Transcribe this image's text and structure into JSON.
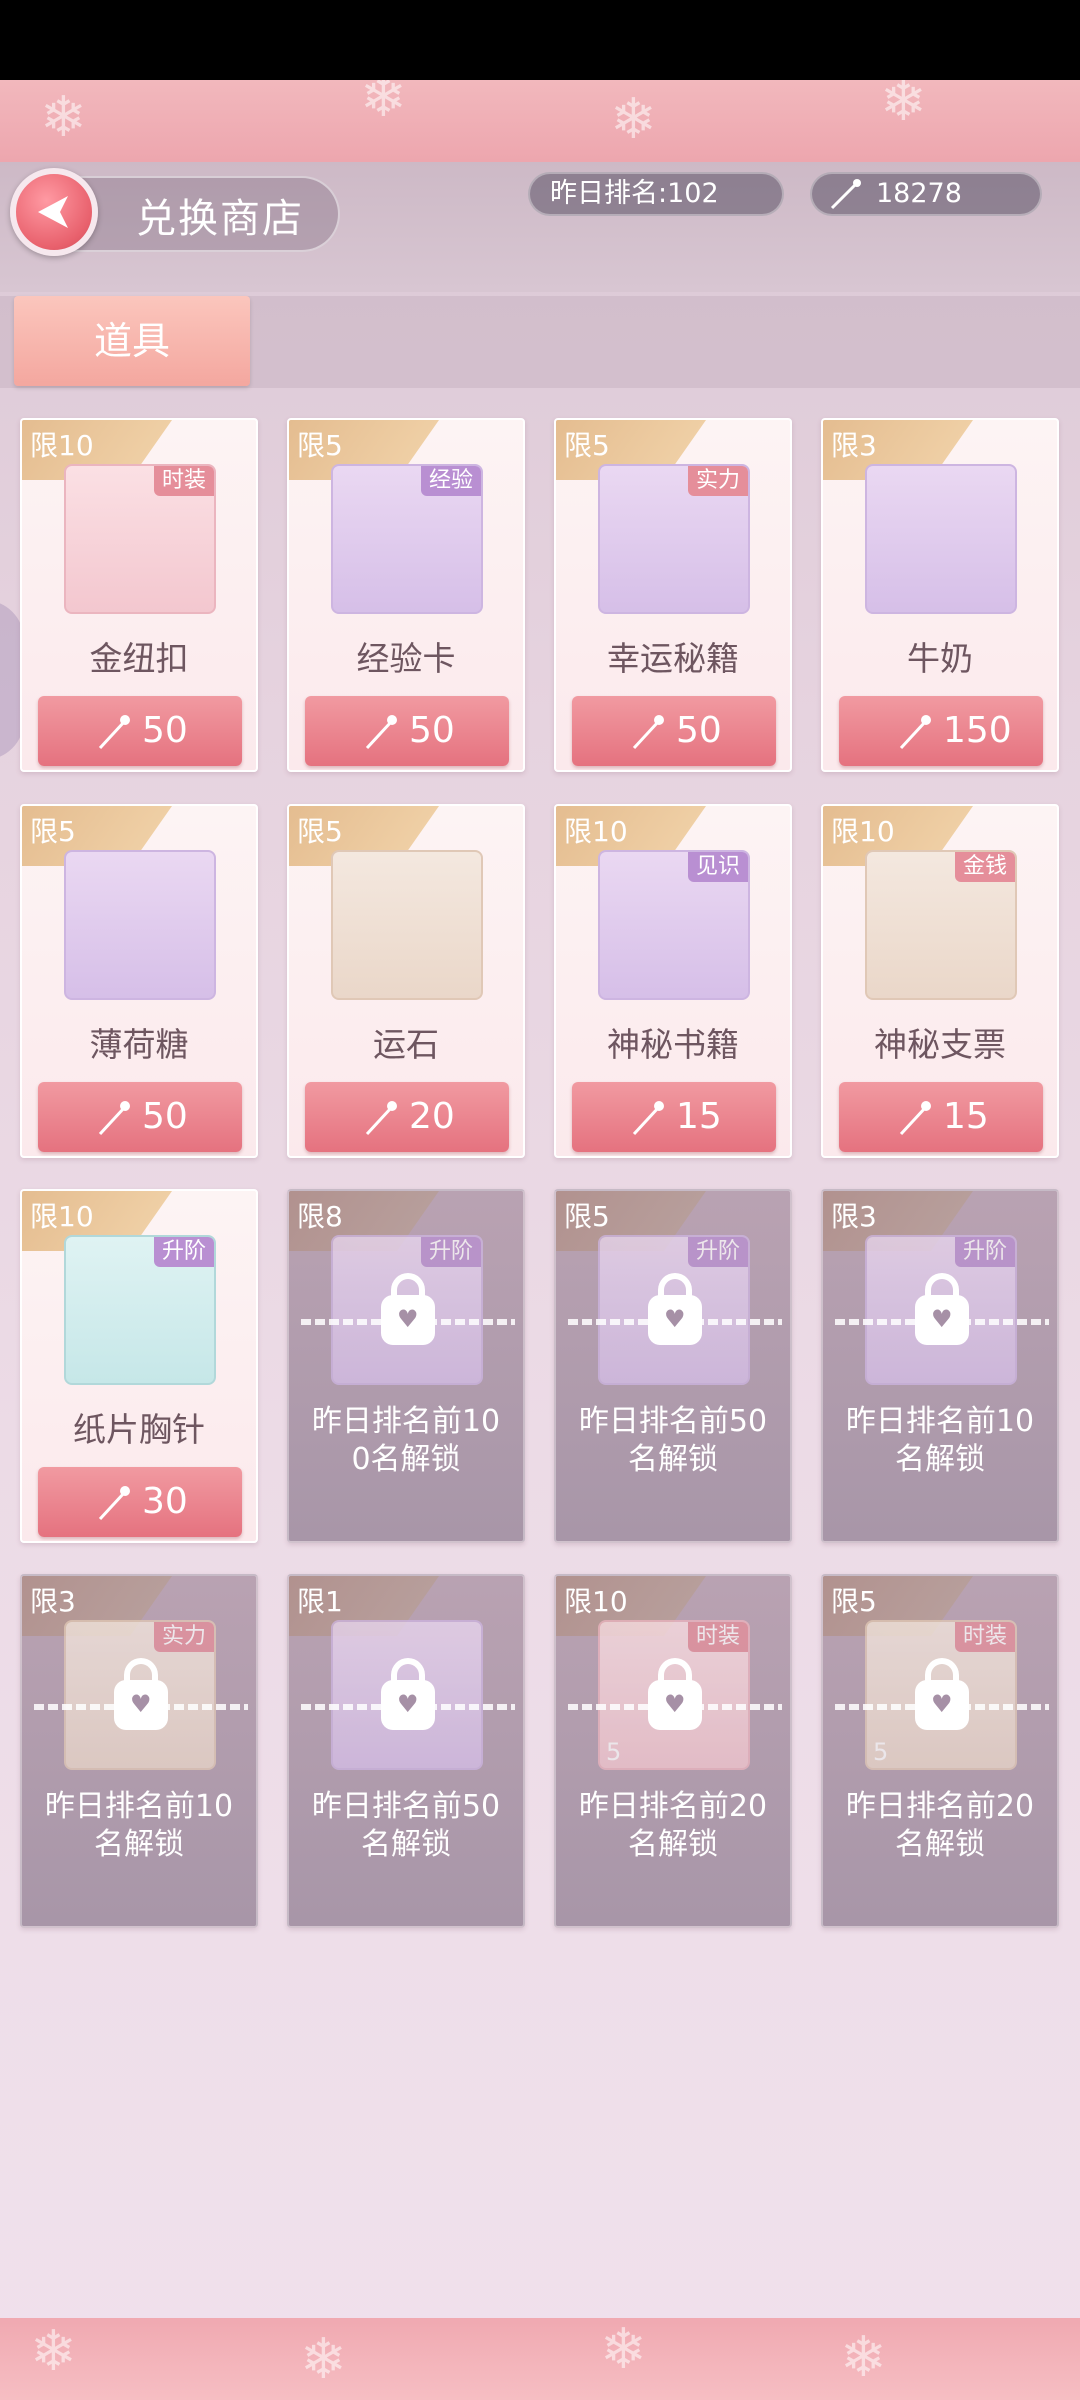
{
  "header": {
    "title": "兑换商店",
    "rank_text": "昨日排名:102",
    "currency_amount": "18278"
  },
  "tabs": [
    {
      "label": "道具",
      "active": true
    }
  ],
  "items": [
    {
      "limit": "限10",
      "tag": "时装",
      "name": "金纽扣",
      "price": "50",
      "locked": false
    },
    {
      "limit": "限5",
      "tag": "经验",
      "name": "经验卡",
      "price": "50",
      "locked": false
    },
    {
      "limit": "限5",
      "tag": "实力",
      "name": "幸运秘籍",
      "price": "50",
      "locked": false
    },
    {
      "limit": "限3",
      "tag": "",
      "name": "牛奶",
      "price": "150",
      "locked": false
    },
    {
      "limit": "限5",
      "tag": "",
      "name": "薄荷糖",
      "price": "50",
      "locked": false
    },
    {
      "limit": "限5",
      "tag": "",
      "name": "运石",
      "price": "20",
      "locked": false
    },
    {
      "limit": "限10",
      "tag": "见识",
      "name": "神秘书籍",
      "price": "15",
      "locked": false
    },
    {
      "limit": "限10",
      "tag": "金钱",
      "name": "神秘支票",
      "price": "15",
      "locked": false
    },
    {
      "limit": "限10",
      "tag": "升阶",
      "name": "纸片胸针",
      "price": "30",
      "locked": false
    },
    {
      "limit": "限8",
      "tag": "升阶",
      "unlock_line1": "昨日排名前10",
      "unlock_line2": "0名解锁",
      "locked": true,
      "qty": ""
    },
    {
      "limit": "限5",
      "tag": "升阶",
      "unlock_line1": "昨日排名前50",
      "unlock_line2": "名解锁",
      "locked": true,
      "qty": ""
    },
    {
      "limit": "限3",
      "tag": "升阶",
      "unlock_line1": "昨日排名前10",
      "unlock_line2": "名解锁",
      "locked": true,
      "qty": ""
    },
    {
      "limit": "限3",
      "tag": "实力",
      "unlock_line1": "昨日排名前10",
      "unlock_line2": "名解锁",
      "locked": true,
      "qty": ""
    },
    {
      "limit": "限1",
      "tag": "",
      "unlock_line1": "昨日排名前50",
      "unlock_line2": "名解锁",
      "locked": true,
      "qty": ""
    },
    {
      "limit": "限10",
      "tag": "时装",
      "unlock_line1": "昨日排名前20",
      "unlock_line2": "名解锁",
      "locked": true,
      "qty": "5"
    },
    {
      "limit": "限5",
      "tag": "时装",
      "unlock_line1": "昨日排名前20",
      "unlock_line2": "名解锁",
      "locked": true,
      "qty": "5"
    }
  ],
  "colors": {
    "accent_pink": "#e5727f",
    "ribbon_gold": "#e2b98c",
    "tag_purple": "#b98fd2"
  },
  "icons": [
    "back-arrow-icon",
    "wand-currency-icon",
    "lock-icon"
  ]
}
